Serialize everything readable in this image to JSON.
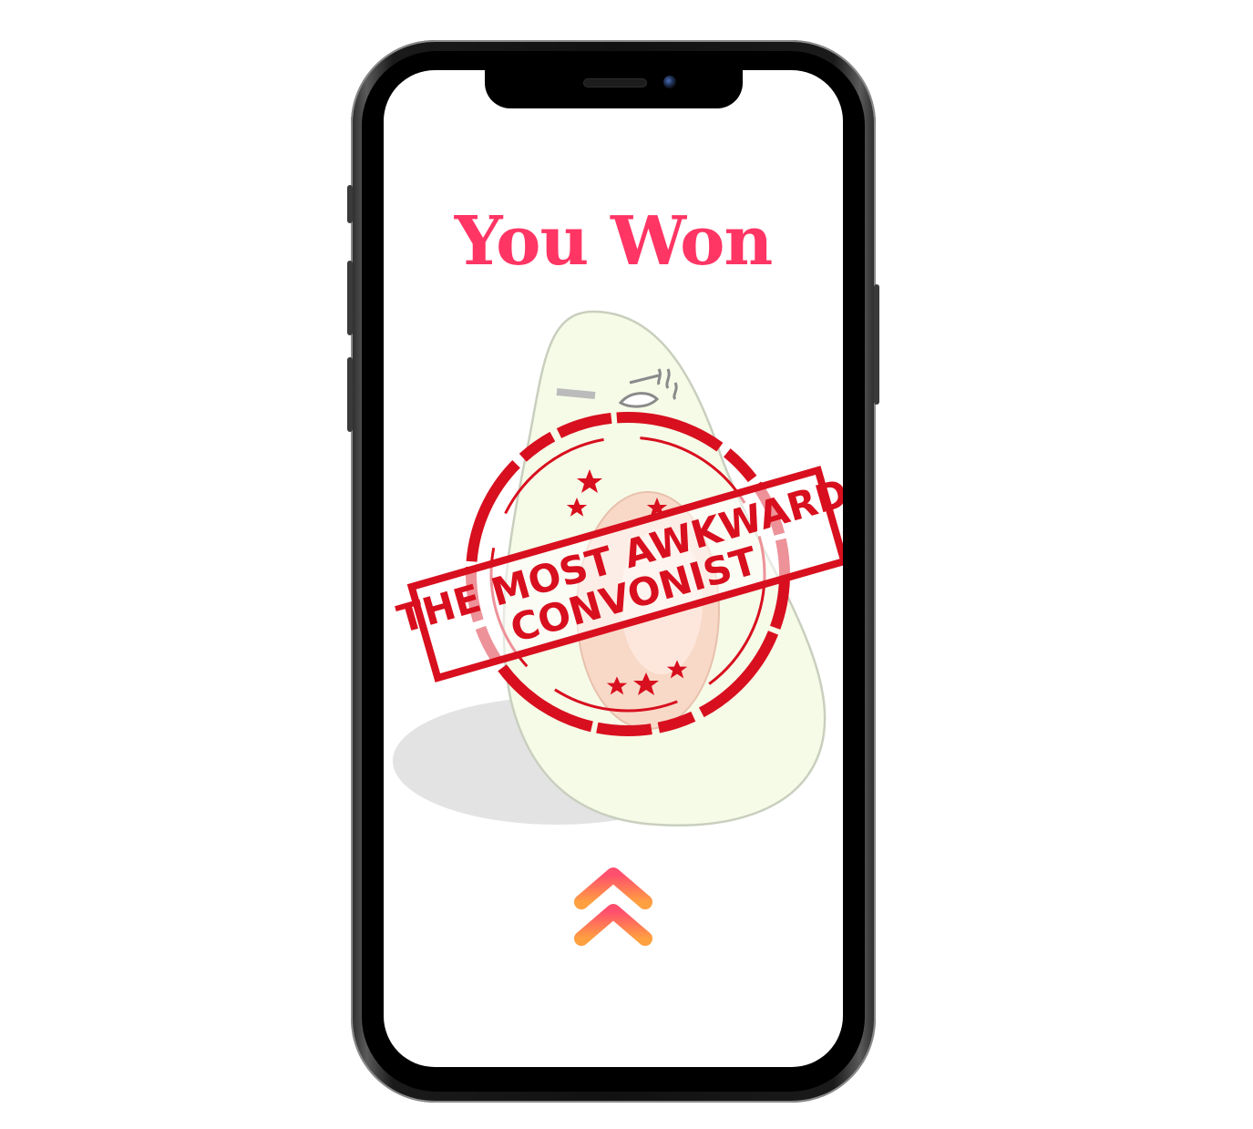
{
  "screen": {
    "title": "You Won"
  },
  "award": {
    "stamp_line_1": "THE MOST AWKWARD",
    "stamp_line_2": "CONVONIST"
  },
  "icons": {
    "illustration": "awkward-avocado-icon",
    "stamp": "award-stamp-icon",
    "swipe_up": "double-chevron-up-icon"
  },
  "colors": {
    "title": "#ff3564",
    "stamp": "#d80f1e",
    "chevron_top": "#ff4f6e",
    "chevron_bottom": "#ffa040",
    "avocado_flesh": "#f5fae6",
    "avocado_pit": "#ffd6c2"
  }
}
